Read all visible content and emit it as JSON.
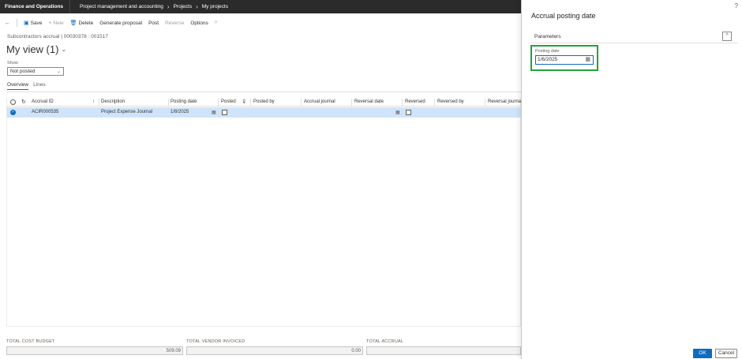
{
  "topbar": {
    "app_title": "Finance and Operations",
    "breadcrumb": [
      "Project management and accounting",
      "Projects",
      "My projects"
    ]
  },
  "actionbar": {
    "back_icon": "arrow-left-icon",
    "save": "Save",
    "new": "New",
    "delete": "Delete",
    "generate_proposal": "Generate proposal",
    "post": "Post",
    "reverse": "Reverse",
    "options": "Options",
    "search_icon": "search-icon"
  },
  "page": {
    "caption": "Subcontractors accrual  |  00030378 : 001517",
    "view_title": "My view (1)",
    "show_label": "Show",
    "show_value": "Not posted",
    "tabs": [
      "Overview",
      "Lines"
    ],
    "active_tab": "Overview"
  },
  "grid": {
    "columns": [
      "Accrual ID",
      "Description",
      "Posting date",
      "Posted",
      "Posted by",
      "Accrual journal",
      "Reversal date",
      "Reversed",
      "Reversed by",
      "Reversal journa"
    ],
    "rows": [
      {
        "accrual_id": "ACIR000535",
        "description": "Project Expense Journal",
        "posting_date": "1/8/2025",
        "posted": false,
        "posted_by": "",
        "accrual_journal": "",
        "reversal_date": "",
        "reversed": false,
        "reversed_by": "",
        "reversal_journal": ""
      }
    ]
  },
  "footer": {
    "total_cost_budget_label": "TOTAL COST BUDGET",
    "total_cost_budget": "509.09",
    "total_vendor_invoiced_label": "TOTAL VENDOR INVOICED",
    "total_vendor_invoiced": "0.00",
    "total_accrual_label": "TOTAL ACCRUAL",
    "total_accrual": ""
  },
  "panel": {
    "help": "?",
    "title": "Accrual posting date",
    "section_label": "Parameters",
    "posting_date_label": "Posting date",
    "posting_date_value": "1/6/2025",
    "ok": "OK",
    "cancel": "Cancel"
  },
  "colors": {
    "accent": "#0f6cbd",
    "topbar_bg": "#2b2b2b",
    "selected_row": "#cfe4fa",
    "highlight_border": "#21a33a"
  }
}
